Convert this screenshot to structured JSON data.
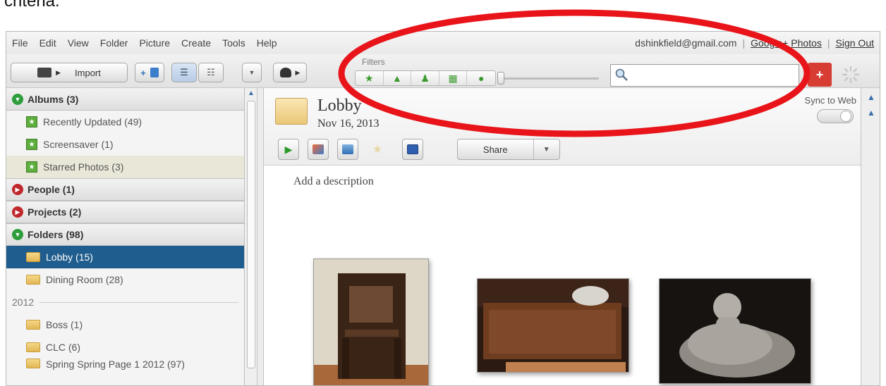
{
  "caption": "criteria.",
  "menu": [
    "File",
    "Edit",
    "View",
    "Folder",
    "Picture",
    "Create",
    "Tools",
    "Help"
  ],
  "account": {
    "email": "dshinkfield@gmail.com",
    "google_photos": "Google+ Photos",
    "sign_out": "Sign Out",
    "separator": "|"
  },
  "toolbar": {
    "import_label": "Import",
    "filters_label": "Filters",
    "search_placeholder": "",
    "gplus_label": "+"
  },
  "sidebar": {
    "albums": "Albums (3)",
    "album_items": [
      "Recently Updated (49)",
      "Screensaver (1)",
      "Starred Photos (3)"
    ],
    "people": "People (1)",
    "projects": "Projects (2)",
    "folders": "Folders (98)",
    "folder_items": [
      "Lobby (15)",
      "Dining Room (28)"
    ],
    "year": "2012",
    "year_items": [
      "Boss (1)",
      "CLC (6)",
      "Spring Spring Page 1 2012 (97)"
    ]
  },
  "main": {
    "title": "Lobby",
    "date": "Nov 16, 2013",
    "sync_label": "Sync to Web",
    "share_label": "Share",
    "description_placeholder": "Add a description"
  },
  "colors": {
    "annotation": "#e8141a",
    "selected_folder": "#1f5d8e",
    "gplus": "#d73d32"
  }
}
